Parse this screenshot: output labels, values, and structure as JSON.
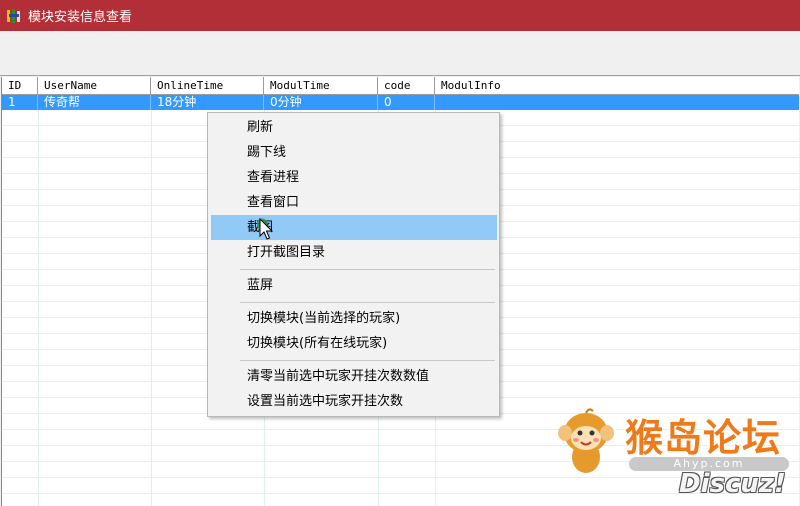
{
  "window": {
    "title": "模块安装信息查看"
  },
  "table": {
    "columns": [
      "ID",
      "UserName",
      "OnlineTime",
      "ModulTime",
      "code",
      "ModulInfo"
    ],
    "rows": [
      {
        "id": "1",
        "username": "传奇帮",
        "onlinetime": "18分钟",
        "modultime": "0分钟",
        "code": "0",
        "modulinfo": ""
      }
    ]
  },
  "context_menu": {
    "items": [
      {
        "label": "刷新"
      },
      {
        "label": "踢下线"
      },
      {
        "label": "查看进程"
      },
      {
        "label": "查看窗口"
      },
      {
        "label": "截图",
        "highlighted": true
      },
      {
        "label": "打开截图目录"
      },
      {
        "label": "蓝屏"
      },
      {
        "label": "切换模块(当前选择的玩家)"
      },
      {
        "label": "切换模块(所有在线玩家)"
      },
      {
        "label": "清零当前选中玩家开挂次数数值"
      },
      {
        "label": "设置当前选中玩家开挂次数"
      }
    ]
  },
  "watermark": {
    "name": "猴岛论坛",
    "url": "Ahyp.com",
    "brand": "Discuz!"
  },
  "colors": {
    "titlebar": "#b32f37",
    "selection": "#3399ff",
    "menu_highlight": "#91c9f7",
    "watermark_orange": "#ef7a1a"
  }
}
